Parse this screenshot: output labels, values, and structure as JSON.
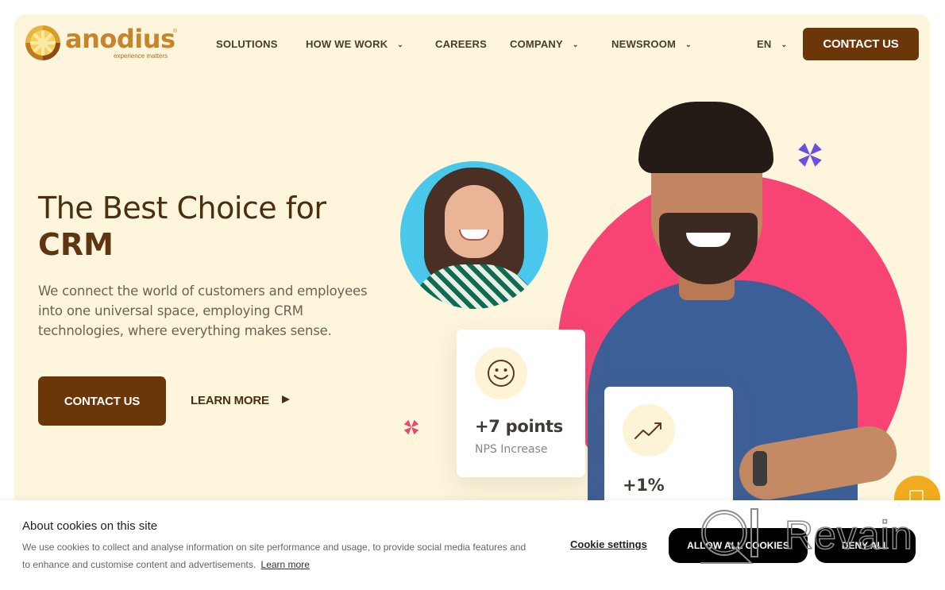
{
  "brand": {
    "name": "anodius",
    "tagline": "experience matters",
    "registered_mark": "®",
    "colors": {
      "primary": "#6b3608",
      "background": "#fdf5dc",
      "accent_pink": "#f74474",
      "accent_blue": "#49c8ec",
      "accent_purple": "#6a4fe0",
      "fab": "#f0ac1e"
    }
  },
  "nav": {
    "items": [
      {
        "label": "SOLUTIONS",
        "has_dropdown": false
      },
      {
        "label": "HOW WE WORK",
        "has_dropdown": true
      },
      {
        "label": "CAREERS",
        "has_dropdown": false
      },
      {
        "label": "COMPANY",
        "has_dropdown": true
      },
      {
        "label": "NEWSROOM",
        "has_dropdown": true
      }
    ],
    "language": "EN",
    "chevron": "⌄",
    "cta_label": "CONTACT US"
  },
  "hero": {
    "title_line1": "The Best Choice for",
    "title_line2": "CRM",
    "description": "We connect the world of customers and employees into one universal space, employing CRM technologies, where everything makes sense.",
    "primary_cta": "CONTACT US",
    "secondary_cta": "LEARN MORE"
  },
  "stats": [
    {
      "icon": "smiley-icon",
      "value": "+7 points",
      "label": "NPS Increase"
    },
    {
      "icon": "trend-up-icon",
      "value": "+1%",
      "label": ""
    }
  ],
  "cookie_banner": {
    "title": "About cookies on this site",
    "text": "We use cookies to collect and analyse information on site performance and usage, to provide social media features and to enhance and customise content and advertisements.",
    "learn_more": "Learn more",
    "settings_label": "Cookie settings",
    "allow_all_label": "ALLOW ALL COOKIES",
    "deny_all_label": "DENY ALL"
  },
  "watermark": {
    "text": "Revain"
  }
}
